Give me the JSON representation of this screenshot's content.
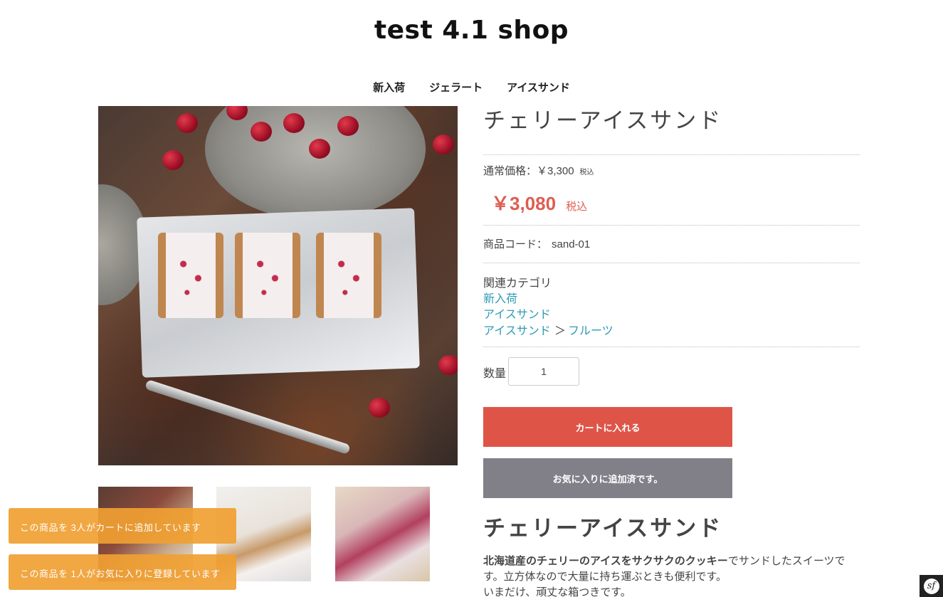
{
  "shop": {
    "title": "test 4.1 shop"
  },
  "nav": {
    "items": [
      "新入荷",
      "ジェラート",
      "アイスサンド"
    ]
  },
  "product": {
    "name": "チェリーアイスサンド",
    "regular_price_label": "通常価格：￥3,300",
    "regular_price_tax": "税込",
    "sale_price": "￥3,080",
    "sale_price_tax": "税込",
    "code_label": "商品コード：",
    "code_value": "sand-01",
    "categories_title": "関連カテゴリ",
    "categories": [
      "新入荷",
      "アイスサンド"
    ],
    "category_path": {
      "parent": "アイスサンド",
      "separator": "＞",
      "child": "フルーツ"
    },
    "quantity_label": "数量",
    "quantity_value": "1",
    "add_to_cart_label": "カートに入れる",
    "favorite_label": "お気に入りに追加済です。",
    "description_title": "チェリーアイスサンド",
    "description_bold": "北海道産のチェリーのアイスをサクサクのクッキー",
    "description_rest": "でサンドしたスイーツです。立方体なので大量に持ち運ぶときも便利です。",
    "description_line2": "いまだけ、頑丈な箱つきです。"
  },
  "notifications": [
    "この商品を 3人がカートに追加しています",
    "この商品を 1人がお気に入りに登録しています"
  ],
  "debug_badge": {
    "icon": "symfony-icon",
    "glyph": "sf"
  },
  "colors": {
    "accent_price": "#de5d50",
    "cart_button": "#de5548",
    "favorite_button": "#818089",
    "link": "#2e9bb5",
    "toast": "#f0a032"
  }
}
